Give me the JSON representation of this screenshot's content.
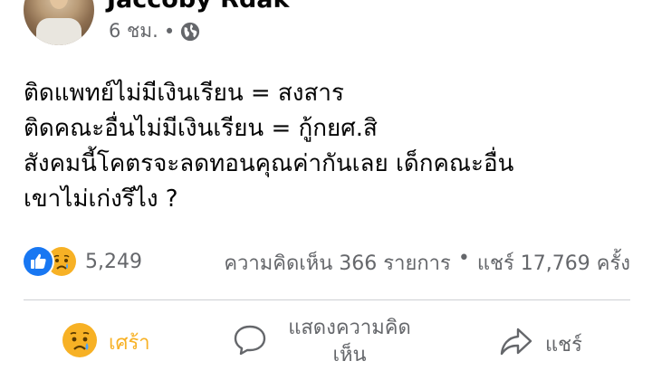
{
  "post": {
    "author": "Jaccoby Rdak",
    "time": "6 ชม.",
    "separator": "•",
    "privacy_icon": "globe-icon",
    "lines": [
      "ติดแพทย์ไม่มีเงินเรียน = สงสาร",
      "ติดคณะอื่นไม่มีเงินเรียน = กู้กยศ.สิ",
      "สังคมนี้โคตรจะลดทอนคุณค่ากันเลย เด็กคณะอื่น",
      "เขาไม่เก่งรึไง ?"
    ]
  },
  "reactions": {
    "icons": [
      "like-icon",
      "sad-icon"
    ],
    "count": "5,249"
  },
  "stats": {
    "comments": "ความคิดเห็น 366 รายการ",
    "separator": "•",
    "shares": "แชร์ 17,769 ครั้ง"
  },
  "actions": {
    "react_label": "เศร้า",
    "comment_label": "แสดงความคิดเห็น",
    "share_label": "แชร์"
  },
  "colors": {
    "like_blue": "#1877f2",
    "sad_yellow": "#f7b125",
    "muted_text": "#65676b"
  }
}
